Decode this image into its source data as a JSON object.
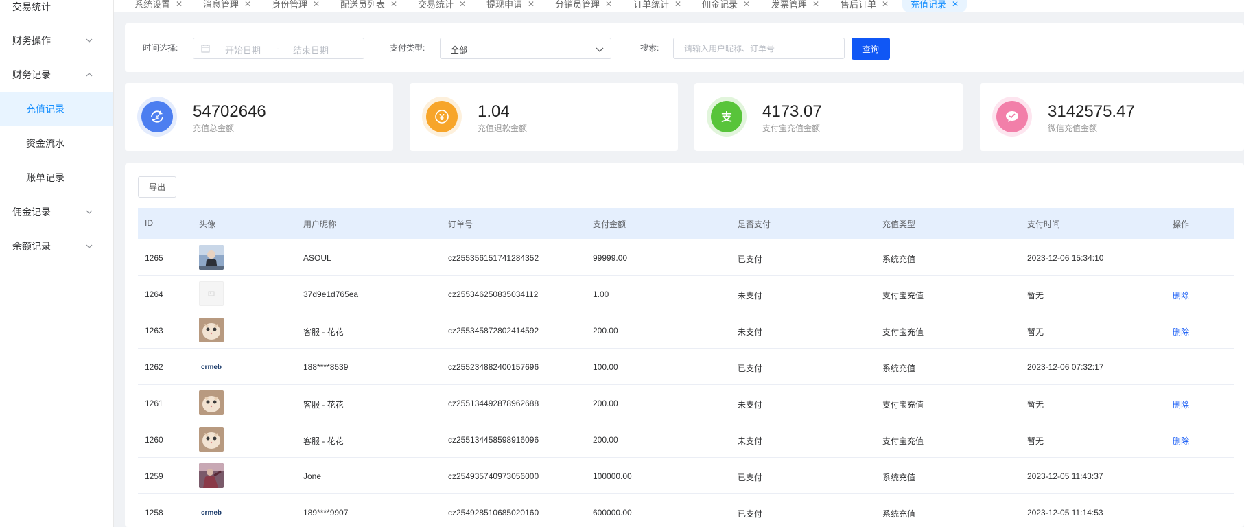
{
  "sidebar": {
    "items": [
      {
        "label": "交易统计",
        "type": "top"
      },
      {
        "label": "财务操作",
        "type": "group",
        "expanded": false
      },
      {
        "label": "财务记录",
        "type": "group",
        "expanded": true
      },
      {
        "label": "充值记录",
        "type": "sub",
        "active": true
      },
      {
        "label": "资金流水",
        "type": "sub"
      },
      {
        "label": "账单记录",
        "type": "sub"
      },
      {
        "label": "佣金记录",
        "type": "group",
        "expanded": false
      },
      {
        "label": "余额记录",
        "type": "group",
        "expanded": false
      }
    ]
  },
  "tabs": [
    {
      "label": "系统设置"
    },
    {
      "label": "消息管理"
    },
    {
      "label": "身份管理"
    },
    {
      "label": "配送员列表"
    },
    {
      "label": "交易统计"
    },
    {
      "label": "提现申请"
    },
    {
      "label": "分销员管理"
    },
    {
      "label": "订单统计"
    },
    {
      "label": "佣金记录"
    },
    {
      "label": "发票管理"
    },
    {
      "label": "售后订单"
    },
    {
      "label": "充值记录",
      "active": true
    }
  ],
  "filters": {
    "time_label": "时间选择:",
    "start_placeholder": "开始日期",
    "date_separator": "-",
    "end_placeholder": "结束日期",
    "pay_type_label": "支付类型:",
    "pay_type_value": "全部",
    "search_label": "搜索:",
    "search_placeholder": "请输入用户昵称、订单号",
    "query_button": "查询"
  },
  "stats": [
    {
      "value": "54702646",
      "label": "充值总金额",
      "icon": "refresh-yen-icon",
      "color": "#4c7ef0",
      "halo": "#e4ecfd"
    },
    {
      "value": "1.04",
      "label": "充值退款金额",
      "icon": "yen-icon",
      "color": "#f7a52a",
      "halo": "#fdf0dc"
    },
    {
      "value": "4173.07",
      "label": "支付宝充值金额",
      "icon": "alipay-icon",
      "color": "#58c43a",
      "halo": "#e2f5dc"
    },
    {
      "value": "3142575.47",
      "label": "微信充值金额",
      "icon": "wechat-icon",
      "color": "#f27fa9",
      "halo": "#fde5ef"
    }
  ],
  "table": {
    "export_button": "导出",
    "columns": [
      "ID",
      "头像",
      "用户昵称",
      "订单号",
      "支付金额",
      "是否支付",
      "充值类型",
      "支付时间",
      "操作"
    ],
    "rows": [
      {
        "id": "1265",
        "avatar": "photo-avatar",
        "nickname": "ASOUL",
        "order_no": "cz255356151741284352",
        "amount": "99999.00",
        "paid": "已支付",
        "type": "系统充值",
        "time": "2023-12-06 15:34:10",
        "action": ""
      },
      {
        "id": "1264",
        "avatar": "placeholder-avatar",
        "nickname": "37d9e1d765ea",
        "order_no": "cz255346250835034112",
        "amount": "1.00",
        "paid": "未支付",
        "type": "支付宝充值",
        "time": "暂无",
        "action": "删除"
      },
      {
        "id": "1263",
        "avatar": "cat-avatar",
        "nickname": "客服 - 花花",
        "order_no": "cz255345872802414592",
        "amount": "200.00",
        "paid": "未支付",
        "type": "支付宝充值",
        "time": "暂无",
        "action": "删除"
      },
      {
        "id": "1262",
        "avatar": "crmeb-logo-avatar",
        "nickname": "188****8539",
        "order_no": "cz255234882400157696",
        "amount": "100.00",
        "paid": "已支付",
        "type": "系统充值",
        "time": "2023-12-06 07:32:17",
        "action": ""
      },
      {
        "id": "1261",
        "avatar": "cat-avatar",
        "nickname": "客服 - 花花",
        "order_no": "cz255134492878962688",
        "amount": "200.00",
        "paid": "未支付",
        "type": "支付宝充值",
        "time": "暂无",
        "action": "删除"
      },
      {
        "id": "1260",
        "avatar": "cat-avatar",
        "nickname": "客服 - 花花",
        "order_no": "cz255134458598916096",
        "amount": "200.00",
        "paid": "未支付",
        "type": "支付宝充值",
        "time": "暂无",
        "action": "删除"
      },
      {
        "id": "1259",
        "avatar": "person-photo-avatar",
        "nickname": "Jone",
        "order_no": "cz254935740973056000",
        "amount": "100000.00",
        "paid": "已支付",
        "type": "系统充值",
        "time": "2023-12-05 11:43:37",
        "action": ""
      },
      {
        "id": "1258",
        "avatar": "crmeb-logo-avatar",
        "nickname": "189****9907",
        "order_no": "cz254928510685020160",
        "amount": "600000.00",
        "paid": "已支付",
        "type": "系统充值",
        "time": "2023-12-05 11:14:53",
        "action": ""
      }
    ]
  },
  "logo_text": "crmeb"
}
